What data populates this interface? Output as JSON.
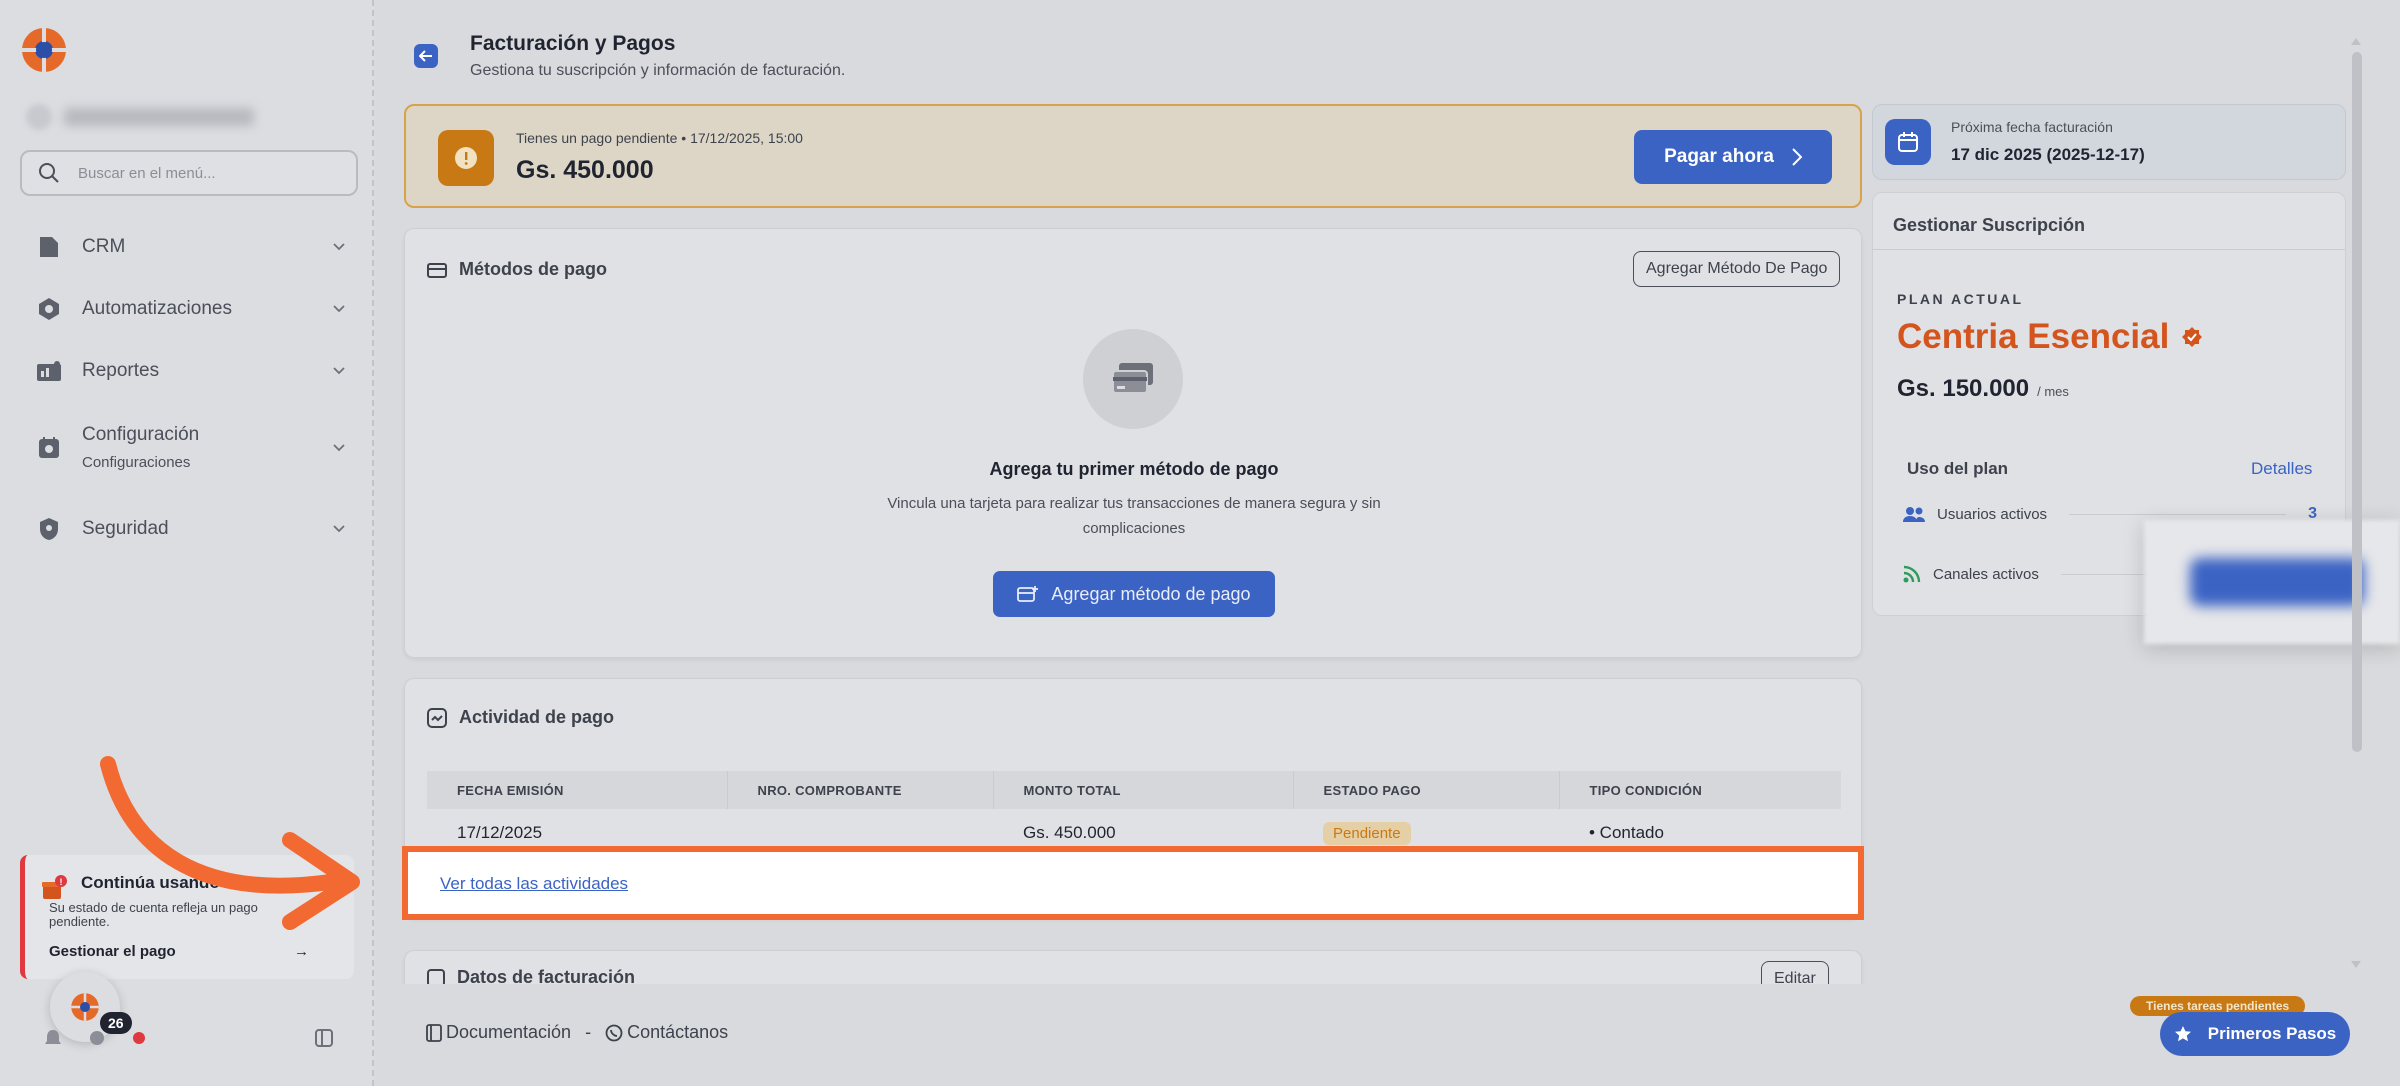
{
  "sidebar": {
    "search_placeholder": "Buscar en el menú...",
    "items": [
      {
        "label": "CRM"
      },
      {
        "label": "Automatizaciones"
      },
      {
        "label": "Reportes"
      },
      {
        "label": "Configuración",
        "sub": "Configuraciones"
      },
      {
        "label": "Seguridad"
      }
    ],
    "card": {
      "title": "Continúa usando Ce",
      "desc": "Su estado de cuenta refleja un pago pendiente.",
      "link": "Gestionar el pago",
      "badge": "!"
    },
    "notification_count": "26"
  },
  "header": {
    "title": "Facturación y Pagos",
    "subtitle": "Gestiona tu suscripción y información de facturación."
  },
  "pending": {
    "text": "Tienes un pago pendiente • 17/12/2025, 15:00",
    "amount": "Gs. 450.000",
    "button": "Pagar ahora"
  },
  "payment_methods": {
    "title": "Métodos de pago",
    "add_button": "Agregar Método De Pago",
    "empty_title": "Agrega tu primer método de pago",
    "empty_desc": "Vincula una tarjeta para realizar tus transacciones de manera segura y sin complicaciones",
    "primary_button": "Agregar método de pago"
  },
  "activity": {
    "title": "Actividad de pago",
    "columns": [
      "FECHA EMISIÓN",
      "NRO. COMPROBANTE",
      "MONTO TOTAL",
      "ESTADO PAGO",
      "TIPO CONDICIÓN"
    ],
    "rows": [
      {
        "date": "17/12/2025",
        "number": "",
        "amount": "Gs. 450.000",
        "status": "Pendiente",
        "condition": "• Contado"
      }
    ],
    "view_all": "Ver todas las actividades"
  },
  "billing_data": {
    "title": "Datos de facturación",
    "edit_button": "Editar"
  },
  "footer": {
    "docs": "Documentación",
    "separator": "-",
    "contact": "Contáctanos"
  },
  "next_billing": {
    "label": "Próxima fecha facturación",
    "date": "17 dic 2025 (2025-12-17)"
  },
  "subscription": {
    "title": "Gestionar Suscripción",
    "plan_label": "PLAN ACTUAL",
    "plan_name": "Centria Esencial",
    "price": "Gs. 150.000",
    "period": "/ mes",
    "usage_title": "Uso del plan",
    "usage_link": "Detalles",
    "usage": [
      {
        "label": "Usuarios activos",
        "value": "3"
      },
      {
        "label": "Canales activos",
        "value": ""
      }
    ]
  },
  "help": {
    "tasks_pill": "Tienes tareas pendientes",
    "first_steps": "Primeros Pasos"
  },
  "colors": {
    "accent": "#3b63c4",
    "warning": "#c97914",
    "plan": "#d4541e",
    "highlight": "#f26a32",
    "alert": "#e0383f"
  }
}
